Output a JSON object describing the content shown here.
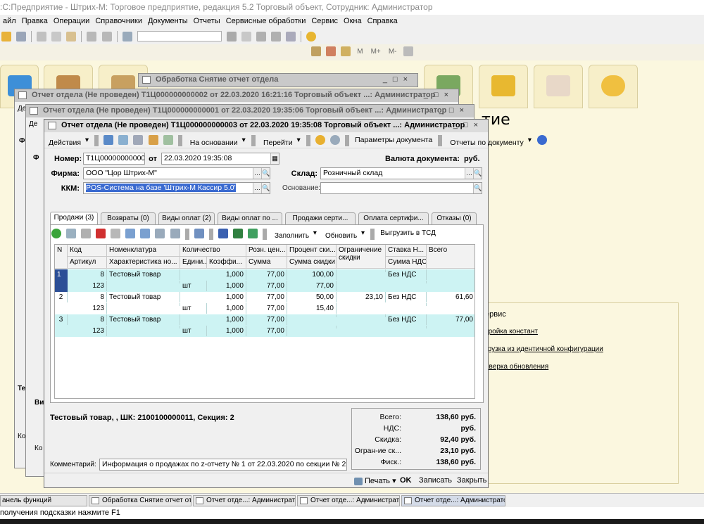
{
  "app": {
    "title": ":С:Предприятие - Штрих-М: Торговое предприятие, редакция 5.2 Торговый объект, Сотрудник: Администратор"
  },
  "menu": [
    "айл",
    "Правка",
    "Операции",
    "Справочники",
    "Документы",
    "Отчеты",
    "Сервисные обработки",
    "Сервис",
    "Окна",
    "Справка"
  ],
  "toolbar2": {
    "labels": [
      "M",
      "M+",
      "M-"
    ]
  },
  "desktop": {
    "title_partial": "тие",
    "service_title": "ервис",
    "service_links": [
      "тройка констант",
      "грузка из идентичной конфигурации",
      "оверка обновления"
    ]
  },
  "bg_windows": {
    "w4": "Обработка  Снятие отчет отдела",
    "w1": "Отчет отдела (Не проведен)  Т1Ц000000000002 от 22.03.2020 16:21:16 Торговый объект ...: Администратор",
    "w2": "Отчет отдела (Не проведен)  Т1Ц000000000001 от 22.03.2020 19:35:06 Торговый объект ...: Администратор",
    "left_fragments": [
      "Де",
      "Ф",
      "Де",
      "Ф",
      "Те",
      "Ви",
      "Ко",
      "Ко"
    ]
  },
  "main": {
    "title": "Отчет отдела (Не проведен)  Т1Ц000000000003 от 22.03.2020 19:35:08 Торговый объект ...: Администратор",
    "toolbar": {
      "actions": "Действия",
      "based_on": "На основании",
      "goto": "Перейти",
      "params": "Параметры документа",
      "reports": "Отчеты по документу"
    },
    "header": {
      "number_label": "Номер:",
      "number": "Т1Ц000000000003",
      "from_label": "от",
      "date": "22.03.2020 19:35:08",
      "currency_label": "Валюта документа:",
      "currency": "руб.",
      "firm_label": "Фирма:",
      "firm": "ООО \"Цор Штрих-М\"",
      "warehouse_label": "Склад:",
      "warehouse": "Розничный склад",
      "kkm_label": "ККМ:",
      "kkm": "POS-Система на базе 'Штрих-М Кассир 5.0'",
      "basis_label": "Основание:",
      "basis": ""
    },
    "tabs": [
      "Продажи (3)",
      "Возвраты (0)",
      "Виды оплат (2)",
      "Виды оплат по ...",
      "Продажи серти...",
      "Оплата сертифи...",
      "Отказы (0)"
    ],
    "tab_toolbar": {
      "fill": "Заполнить",
      "refresh": "Обновить",
      "export": "Выгрузить в ТСД"
    },
    "grid": {
      "headers_top": [
        "N",
        "Код",
        "Номенклатура",
        "Количество",
        "Розн. цен...",
        "Процент ски...",
        "Ограничение скидки",
        "Ставка Н...",
        "Всего"
      ],
      "headers_bottom": [
        "Артикул",
        "Характеристика но...",
        "Едини...",
        "Коэффи...",
        "Сумма",
        "Сумма скидки",
        "Сумма НДС"
      ],
      "rows": [
        {
          "n": "1",
          "code": "8",
          "article": "123",
          "name": "Тестовый товар",
          "char": "",
          "unit": "шт",
          "qty": "1,000",
          "coef": "1,000",
          "price": "77,00",
          "sum": "77,00",
          "disc_pct": "100,00",
          "disc_sum": "77,00",
          "limit": "",
          "vat": "Без НДС",
          "vat_sum": "",
          "total": ""
        },
        {
          "n": "2",
          "code": "8",
          "article": "123",
          "name": "Тестовый товар",
          "char": "",
          "unit": "шт",
          "qty": "1,000",
          "coef": "1,000",
          "price": "77,00",
          "sum": "77,00",
          "disc_pct": "50,00",
          "disc_sum": "15,40",
          "limit": "23,10",
          "vat": "Без НДС",
          "vat_sum": "",
          "total": "61,60"
        },
        {
          "n": "3",
          "code": "8",
          "article": "123",
          "name": "Тестовый товар",
          "char": "",
          "unit": "шт",
          "qty": "1,000",
          "coef": "1,000",
          "price": "77,00",
          "sum": "77,00",
          "disc_pct": "",
          "disc_sum": "",
          "limit": "",
          "vat": "Без НДС",
          "vat_sum": "",
          "total": "77,00"
        }
      ]
    },
    "status_line": "Тестовый товар, , ШК: 2100100000011, Секция: 2",
    "totals": [
      {
        "label": "Всего:",
        "value": "138,60 руб."
      },
      {
        "label": "НДС:",
        "value": "руб."
      },
      {
        "label": "Скидка:",
        "value": "92,40 руб."
      },
      {
        "label": "Огран-ие ск...",
        "value": "23,10 руб."
      },
      {
        "label": "Фиск.:",
        "value": "138,60 руб."
      }
    ],
    "comment_label": "Комментарий:",
    "comment": "Информация о продажах по z-отчету № 1 от 22.03.2020 по секции № 2",
    "buttons": {
      "print": "Печать",
      "ok": "OK",
      "save": "Записать",
      "close": "Закрыть"
    }
  },
  "taskbar": [
    "анель функций",
    "Обработка  Снятие отчет от...",
    "Отчет отде...: Администратор",
    "Отчет отде...: Администратор",
    "Отчет отде...: Администратор"
  ],
  "hint": "получения подсказки нажмите F1"
}
